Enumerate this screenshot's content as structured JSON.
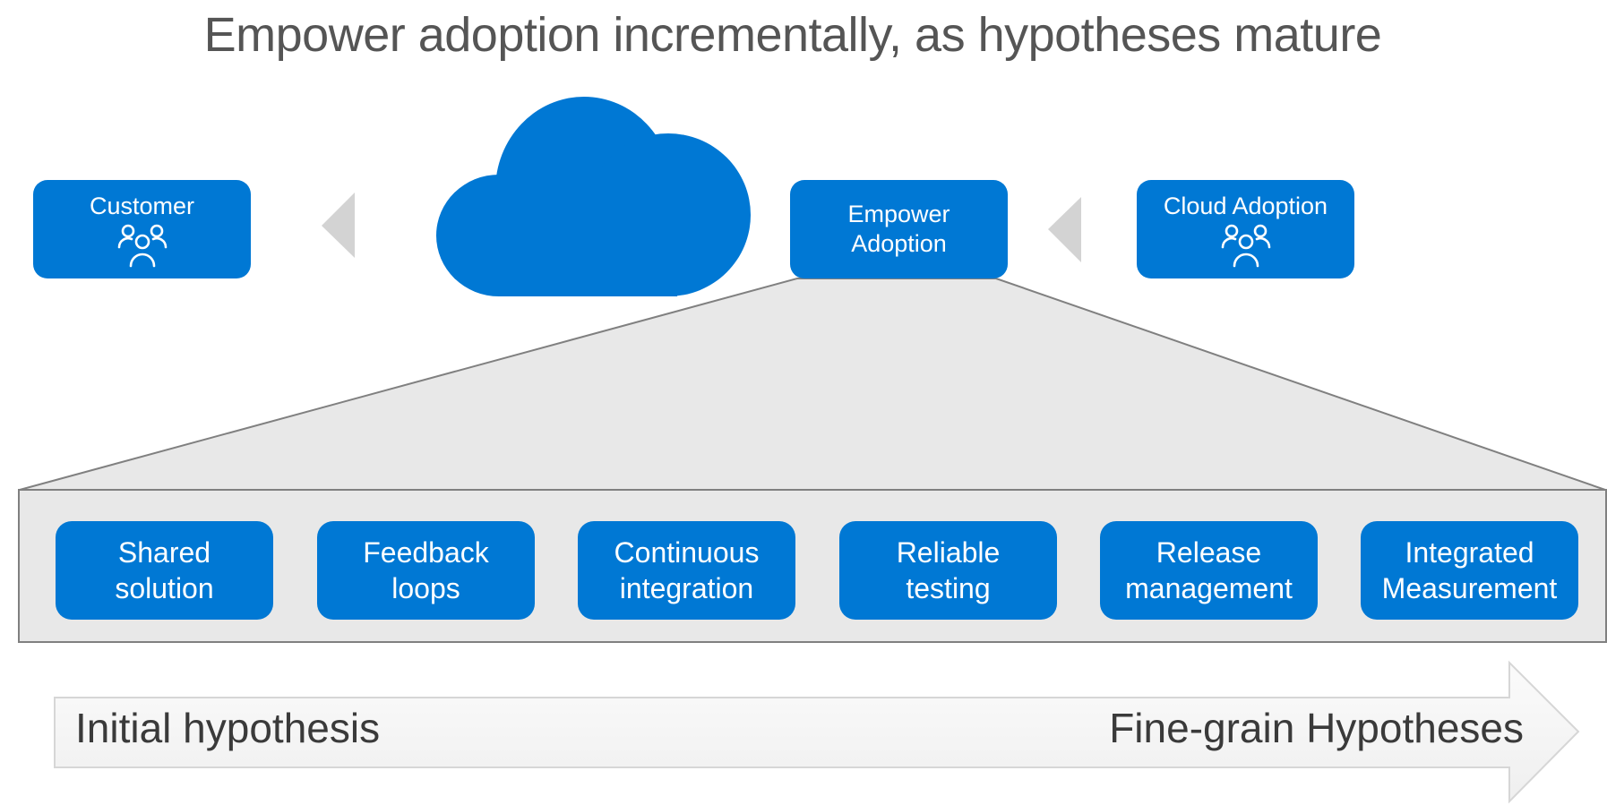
{
  "title": "Empower adoption incrementally, as hypotheses mature",
  "colors": {
    "accent_blue": "#0078d4",
    "panel_gray": "#e8e8e8",
    "panel_border": "#808080",
    "chevron_gray": "#d3d3d3",
    "title_text": "#555555"
  },
  "top_row": {
    "customer": {
      "label": "Customer",
      "icon": "people-icon"
    },
    "cloud": {
      "icon": "cloud-icon"
    },
    "empower": {
      "line1": "Empower",
      "line2": "Adoption"
    },
    "cloud_adoption": {
      "label": "Cloud Adoption",
      "icon": "people-icon"
    }
  },
  "practices": [
    {
      "line1": "Shared",
      "line2": "solution"
    },
    {
      "line1": "Feedback",
      "line2": "loops"
    },
    {
      "line1": "Continuous",
      "line2": "integration"
    },
    {
      "line1": "Reliable",
      "line2": "testing"
    },
    {
      "line1": "Release",
      "line2": "management"
    },
    {
      "line1": "Integrated",
      "line2": "Measurement"
    }
  ],
  "progress_arrow": {
    "start_label": "Initial hypothesis",
    "end_label": "Fine-grain Hypotheses"
  }
}
